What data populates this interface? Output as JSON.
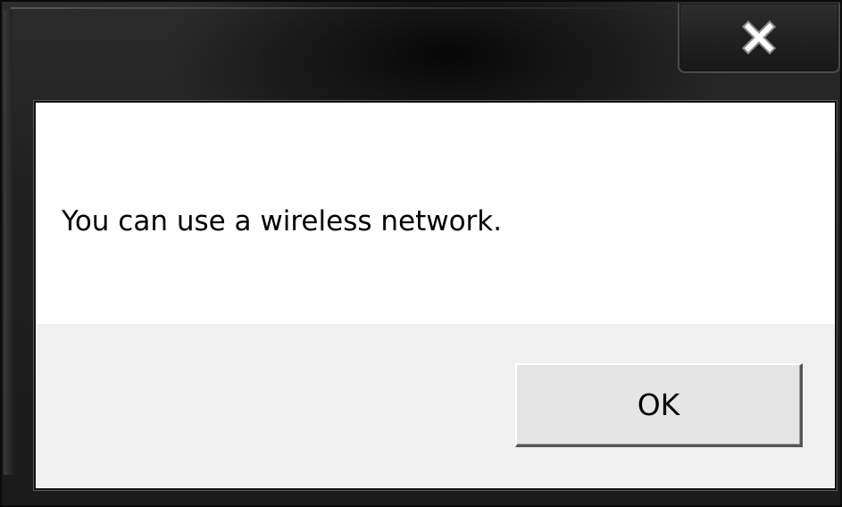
{
  "dialog": {
    "message": "You can use a wireless network.",
    "ok_label": "OK",
    "close_icon": "close-icon"
  }
}
